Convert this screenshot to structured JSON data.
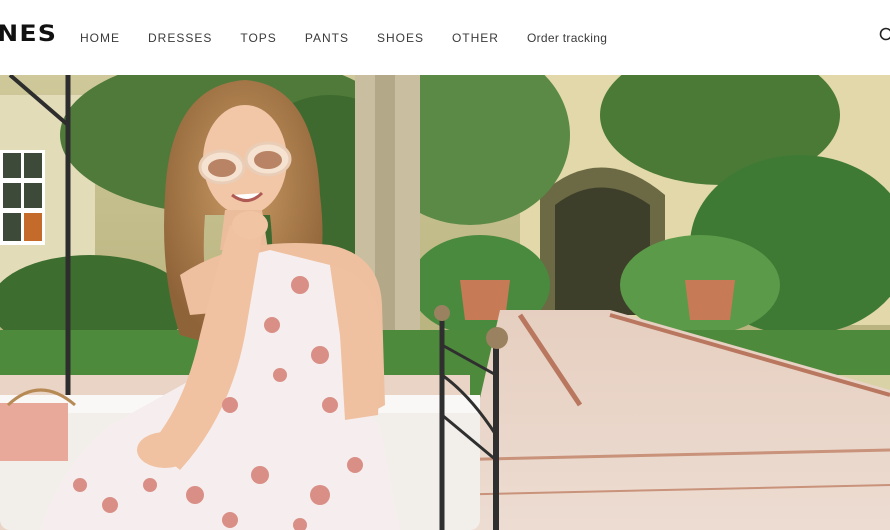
{
  "header": {
    "logo_text": "NES",
    "nav": [
      {
        "label": "HOME"
      },
      {
        "label": "DRESSES"
      },
      {
        "label": "TOPS"
      },
      {
        "label": "PANTS"
      },
      {
        "label": "SHOES"
      },
      {
        "label": "OTHER"
      },
      {
        "label": "Order tracking"
      }
    ],
    "search_icon": "search-icon"
  },
  "hero": {
    "image": "woman-in-floral-dress-seated-in-garden-courtyard"
  },
  "colors": {
    "nav_text": "#3a3a3a",
    "logo": "#111111",
    "background": "#ffffff"
  }
}
